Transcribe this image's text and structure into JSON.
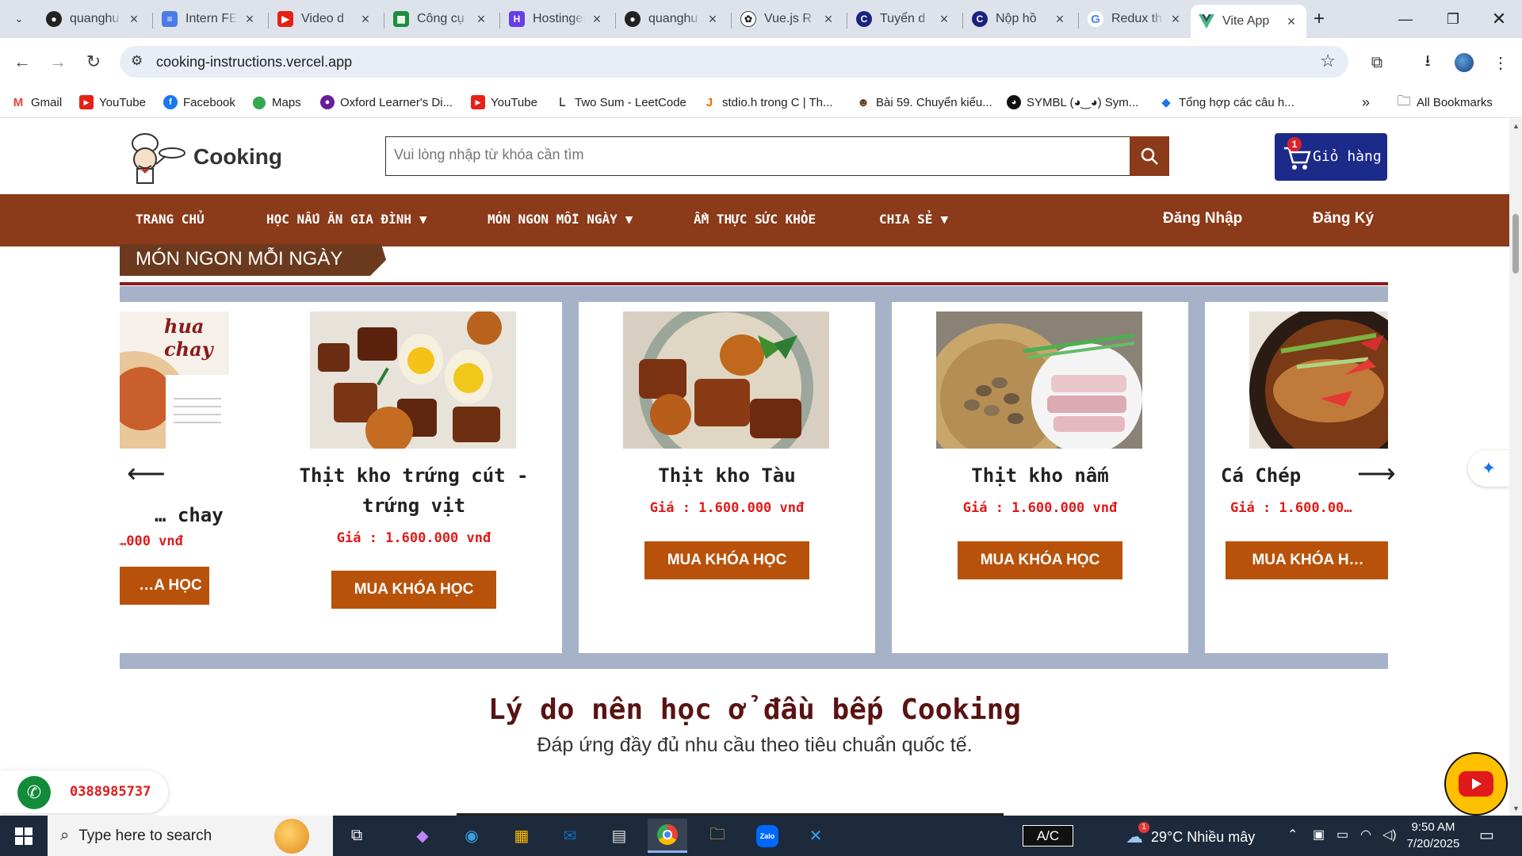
{
  "browser": {
    "tabs": [
      {
        "title": "quanghu",
        "icon": "github"
      },
      {
        "title": "Intern FE",
        "icon": "docs"
      },
      {
        "title": "Video d",
        "icon": "youtube"
      },
      {
        "title": "Công cụ",
        "icon": "sheets"
      },
      {
        "title": "Hostinger",
        "icon": "hostinger"
      },
      {
        "title": "quanghu",
        "icon": "github"
      },
      {
        "title": "Vue.js R",
        "icon": "openai"
      },
      {
        "title": "Tuyển d",
        "icon": "c-logo"
      },
      {
        "title": "Nộp hồ",
        "icon": "c-logo"
      },
      {
        "title": "Redux th",
        "icon": "google"
      },
      {
        "title": "Vite App",
        "icon": "vue",
        "active": true
      }
    ],
    "url": "cooking-instructions.vercel.app",
    "bookmarks": [
      {
        "label": "Gmail",
        "icon": "gmail"
      },
      {
        "label": "YouTube",
        "icon": "youtube"
      },
      {
        "label": "Facebook",
        "icon": "facebook"
      },
      {
        "label": "Maps",
        "icon": "maps"
      },
      {
        "label": "Oxford Learner's Di...",
        "icon": "oxford"
      },
      {
        "label": "YouTube",
        "icon": "youtube"
      },
      {
        "label": "Two Sum - LeetCode",
        "icon": "leetcode"
      },
      {
        "label": "stdio.h trong C | Th...",
        "icon": "java"
      },
      {
        "label": "Bài 59. Chuyển kiểu...",
        "icon": "person"
      },
      {
        "label": "SYMBL (◕‿◕) Sym...",
        "icon": "symbl"
      },
      {
        "label": "Tổng hợp các câu h...",
        "icon": "diamond"
      }
    ],
    "all_bookmarks": "All Bookmarks"
  },
  "site": {
    "brand": "Cooking",
    "search_placeholder": "Vui lòng nhập từ khóa cần tìm",
    "cart_label": "Giỏ hàng",
    "cart_count": "1",
    "menu": [
      {
        "label": "TRANG CHỦ",
        "dropdown": false
      },
      {
        "label": "HỌC NẤU ĂN GIA ĐÌNH",
        "dropdown": true
      },
      {
        "label": "MÓN NGON MỖI NGÀY",
        "dropdown": true
      },
      {
        "label": "ẨM THỰC SỨC KHỎE",
        "dropdown": false
      },
      {
        "label": "CHIA SẺ",
        "dropdown": true
      }
    ],
    "login": "Đăng Nhập",
    "register": "Đăng Ký",
    "section_title": "MÓN NGON MỖI NGÀY",
    "cards": [
      {
        "name": "… chay",
        "price": "…000 vnđ",
        "button": "…A HỌC",
        "image_text": "hua chay"
      },
      {
        "name": "Thịt kho trứng cút - trứng vịt",
        "price": "Giá : 1.600.000 vnđ",
        "button": "MUA KHÓA HỌC"
      },
      {
        "name": "Thịt kho Tàu",
        "price": "Giá : 1.600.000 vnđ",
        "button": "MUA KHÓA HỌC"
      },
      {
        "name": "Thịt kho nấm",
        "price": "Giá : 1.600.000 vnđ",
        "button": "MUA KHÓA HỌC"
      },
      {
        "name": "Cá Chép",
        "price": "Giá : 1.600.00…",
        "button": "MUA KHÓA H…"
      }
    ],
    "reason_title": "Lý do nên học ở đầu bếp Cooking",
    "reason_sub": "Đáp ứng đầy đủ nhu cầu theo tiêu chuẩn quốc tế.",
    "phone": "0388985737"
  },
  "taskbar": {
    "search_placeholder": "Type here to search",
    "ac": "A/C",
    "weather": "29°C  Nhiều mây",
    "weather_badge": "1",
    "time": "9:50 AM",
    "date": "7/20/2025"
  },
  "colors": {
    "menu_bg": "#8b3a1a",
    "button_bg": "#b8520a",
    "cart_bg": "#1c2a8a",
    "price": "#e01a1a"
  }
}
